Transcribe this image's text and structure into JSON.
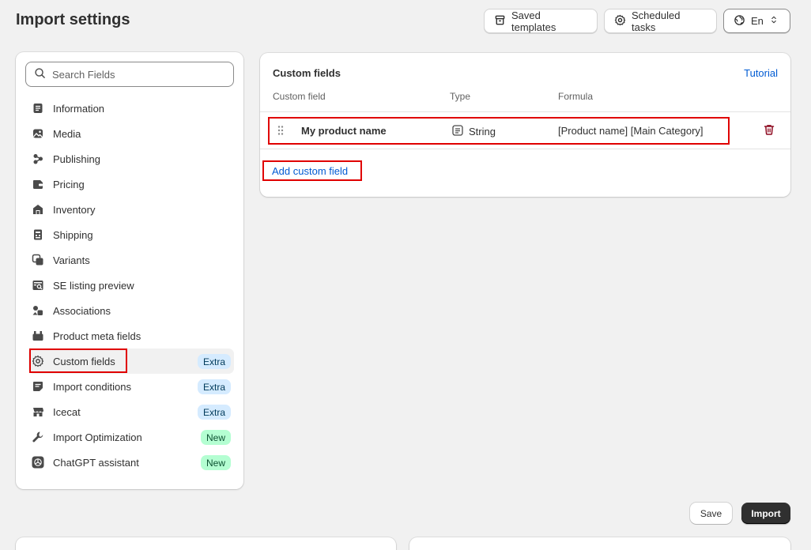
{
  "page": {
    "title": "Import settings"
  },
  "header": {
    "saved_templates": "Saved templates",
    "scheduled_tasks": "Scheduled tasks",
    "language": "En"
  },
  "search": {
    "placeholder": "Search Fields"
  },
  "sidebar": {
    "items": [
      {
        "label": "Information",
        "icon": "info-icon"
      },
      {
        "label": "Media",
        "icon": "image-icon"
      },
      {
        "label": "Publishing",
        "icon": "channels-icon"
      },
      {
        "label": "Pricing",
        "icon": "wallet-icon"
      },
      {
        "label": "Inventory",
        "icon": "warehouse-icon"
      },
      {
        "label": "Shipping",
        "icon": "shipping-label-icon"
      },
      {
        "label": "Variants",
        "icon": "variants-icon"
      },
      {
        "label": "SE listing preview",
        "icon": "search-listing-icon"
      },
      {
        "label": "Associations",
        "icon": "associations-icon"
      },
      {
        "label": "Product meta fields",
        "icon": "metafields-icon"
      },
      {
        "label": "Custom fields",
        "icon": "gear-icon",
        "badge": "Extra",
        "active": true
      },
      {
        "label": "Import conditions",
        "icon": "conditions-icon",
        "badge": "Extra"
      },
      {
        "label": "Icecat",
        "icon": "store-icon",
        "badge": "Extra"
      },
      {
        "label": "Import Optimization",
        "icon": "wrench-icon",
        "badge": "New"
      },
      {
        "label": "ChatGPT assistant",
        "icon": "chatgpt-icon",
        "badge": "New"
      }
    ]
  },
  "custom_fields": {
    "title": "Custom fields",
    "tutorial": "Tutorial",
    "columns": {
      "field": "Custom field",
      "type": "Type",
      "formula": "Formula"
    },
    "rows": [
      {
        "name": "My product name",
        "type": "String",
        "formula": "[Product name] [Main Category]"
      }
    ],
    "add_label": "Add custom field"
  },
  "footer": {
    "save": "Save",
    "import": "Import"
  },
  "colors": {
    "link": "#005bd3",
    "highlight": "#e00000",
    "delete": "#8e0b21",
    "extra_badge": "#d5ebff",
    "new_badge": "#b4fed2"
  }
}
